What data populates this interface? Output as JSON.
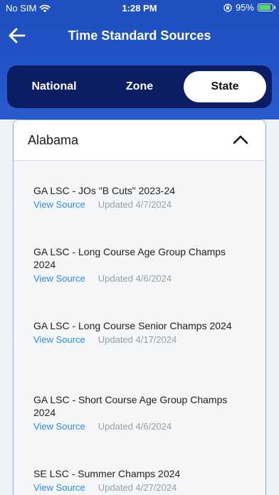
{
  "status_bar": {
    "carrier": "No SIM",
    "time": "1:28 PM",
    "battery": "95%",
    "battery_level": 0.95
  },
  "nav": {
    "title": "Time Standard Sources",
    "back_icon": "arrow-left-icon"
  },
  "tabs": [
    {
      "label": "National",
      "selected": false
    },
    {
      "label": "Zone",
      "selected": false
    },
    {
      "label": "State",
      "selected": true
    }
  ],
  "section": {
    "title": "Alabama",
    "expanded": true,
    "items": [
      {
        "name": "GA LSC - JOs \"B Cuts\" 2023-24",
        "link": "View Source",
        "updated": "Updated 4/7/2024"
      },
      {
        "name": "GA LSC - Long Course Age Group Champs 2024",
        "link": "View Source",
        "updated": "Updated 4/6/2024"
      },
      {
        "name": "GA LSC - Long Course Senior Champs 2024",
        "link": "View Source",
        "updated": "Updated 4/17/2024"
      },
      {
        "name": "GA LSC - Short Course Age Group Champs 2024",
        "link": "View Source",
        "updated": "Updated 4/6/2024"
      },
      {
        "name": "SE LSC - Summer Champs 2024",
        "link": "View Source",
        "updated": "Updated 4/27/2024"
      }
    ]
  },
  "colors": {
    "header_blue": "#2154c6",
    "segment_bg": "#0c1d64",
    "link_blue": "#2d8be6"
  }
}
